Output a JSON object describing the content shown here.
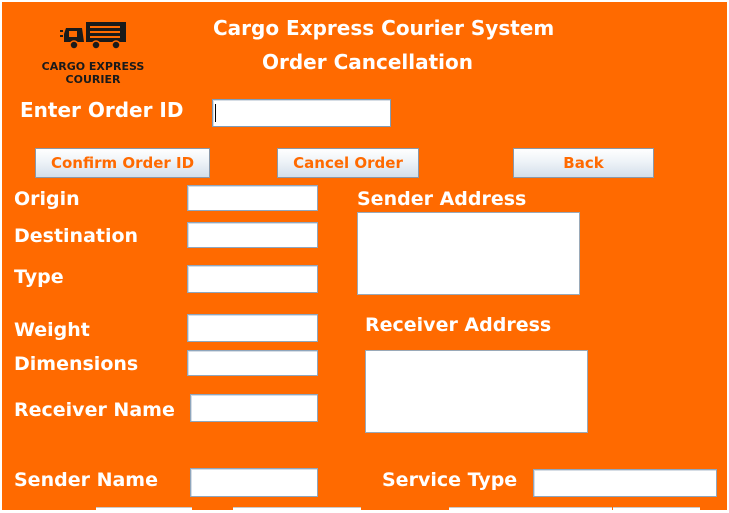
{
  "header": {
    "system_title": "Cargo Express Courier System",
    "page_title": "Order Cancellation"
  },
  "logo": {
    "line1": "CARGO EXPRESS",
    "line2": "COURIER"
  },
  "order_id": {
    "label": "Enter Order ID",
    "value": ""
  },
  "buttons": {
    "confirm": "Confirm Order ID",
    "cancel": "Cancel Order",
    "back": "Back"
  },
  "fields": {
    "origin": "Origin",
    "destination": "Destination",
    "type": "Type",
    "weight": "Weight",
    "dimensions": "Dimensions",
    "receiver_name": "Receiver Name",
    "sender_name": "Sender Name",
    "sender_address": "Sender Address",
    "receiver_address": "Receiver Address",
    "service_type": "Service Type"
  },
  "colors": {
    "background": "#ff6a00",
    "label_text": "#ffffff",
    "button_text": "#ff6a00"
  }
}
